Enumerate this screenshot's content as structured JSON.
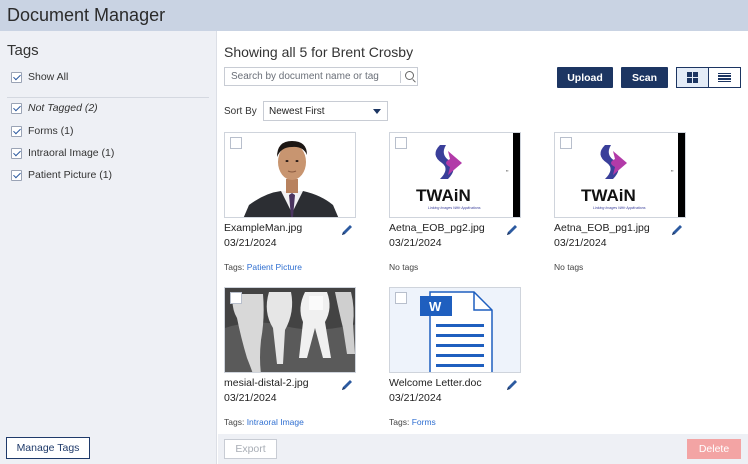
{
  "app": {
    "title": "Document Manager"
  },
  "sidebar": {
    "heading": "Tags",
    "show_all": "Show All",
    "tags": [
      {
        "label": "Not Tagged (2)",
        "italic": true
      },
      {
        "label": "Forms (1)",
        "italic": false
      },
      {
        "label": "Intraoral Image (1)",
        "italic": false
      },
      {
        "label": "Patient Picture (1)",
        "italic": false
      }
    ],
    "manage_button": "Manage Tags"
  },
  "main": {
    "heading": "Showing all 5 for Brent Crosby",
    "search_placeholder": "Search by document name or tag",
    "upload_label": "Upload",
    "scan_label": "Scan",
    "sort_label": "Sort By",
    "sort_value": "Newest First",
    "thumbnail_twain_text": "TWAiN",
    "thumbnail_twain_subtitle": "Linking Images With Applications",
    "thumbnail_word_letter": "W",
    "documents": [
      {
        "name": "ExampleMan.jpg",
        "date": "03/21/2024",
        "tags_prefix": "Tags: ",
        "tag": "Patient Picture",
        "no_tags": ""
      },
      {
        "name": "Aetna_EOB_pg2.jpg",
        "date": "03/21/2024",
        "tags_prefix": "",
        "tag": "",
        "no_tags": "No tags"
      },
      {
        "name": "Aetna_EOB_pg1.jpg",
        "date": "03/21/2024",
        "tags_prefix": "",
        "tag": "",
        "no_tags": "No tags"
      },
      {
        "name": "mesial-distal-2.jpg",
        "date": "03/21/2024",
        "tags_prefix": "Tags: ",
        "tag": "Intraoral Image",
        "no_tags": ""
      },
      {
        "name": "Welcome Letter.doc",
        "date": "03/21/2024",
        "tags_prefix": "Tags: ",
        "tag": "Forms",
        "no_tags": ""
      }
    ]
  },
  "footer": {
    "export_label": "Export",
    "delete_label": "Delete"
  },
  "colors": {
    "primary": "#1c3562",
    "link": "#2f6fd1",
    "delete": "#f3a4a4",
    "titlebar": "#c9d3e3"
  }
}
